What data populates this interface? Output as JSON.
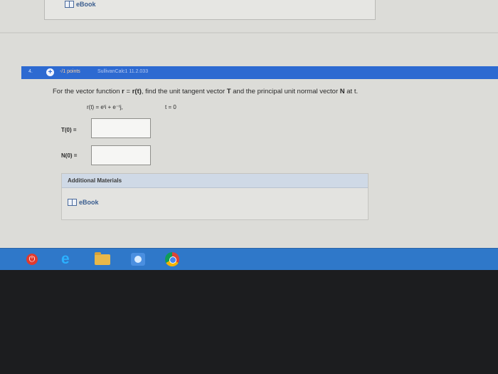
{
  "top_panel": {
    "ebook_label": "eBook"
  },
  "question": {
    "number": "4.",
    "points": "-/1 points",
    "source": "SullivanCalc1 11.2.033",
    "prompt_start": "For the vector function",
    "prompt_r": "r",
    "prompt_eq": " = ",
    "prompt_rt": "r(t)",
    "prompt_mid": ", find the unit tangent vector",
    "prompt_T": "T",
    "prompt_mid2": "and the principal unit normal vector",
    "prompt_N": "N",
    "prompt_end": "at t.",
    "formula": "r(t) = eᵗi + e⁻ᵗj,",
    "t_value": "t = 0",
    "answers": [
      {
        "label": "T(0) =",
        "value": ""
      },
      {
        "label": "N(0) =",
        "value": ""
      }
    ]
  },
  "materials": {
    "header": "Additional Materials",
    "ebook_label": "eBook"
  },
  "taskbar": {
    "icons": [
      "power-icon",
      "internet-explorer-icon",
      "file-explorer-icon",
      "app-icon",
      "chrome-icon"
    ],
    "accent_color": "#2f78c9"
  }
}
